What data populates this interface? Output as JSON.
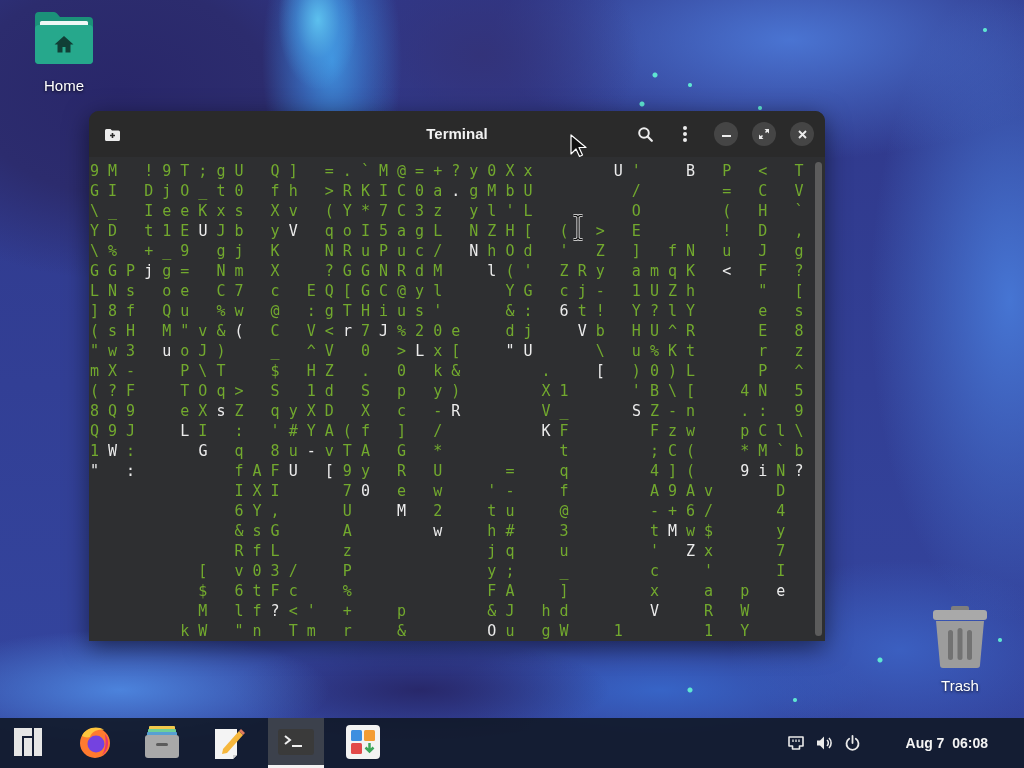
{
  "desktop_icons": [
    {
      "kind": "folder",
      "label": "Home"
    },
    {
      "kind": "trash",
      "label": "Trash"
    }
  ],
  "window": {
    "title": "Terminal",
    "lines": [
      {
        "runs": [
          [
            {
              "kind": "trail",
              "text": "9 M   ! 9 T ; g U   Q ]   = . ` M @ = + ? y 0 X x         "
            },
            {
              "kind": "head",
              "text": "U"
            },
            {
              "kind": "trail",
              "text": " '     "
            },
            {
              "kind": "head",
              "text": "B"
            },
            {
              "kind": "trail",
              "text": "   P   <   T"
            }
          ]
        ]
      },
      {
        "runs": [
          [
            {
              "kind": "trail",
              "text": "G I   D j O _ t 0   f h   > R K I C 0 a "
            },
            {
              "kind": "head",
              "text": "."
            },
            {
              "kind": "trail",
              "text": " g M b U           /         =   C   V"
            }
          ]
        ]
      },
      {
        "runs": [
          [
            {
              "kind": "trail",
              "text": "\\ _   I e e K x s   X v   ( Y * 7 C 3 z   y l ' L           O         (   H   `"
            }
          ]
        ]
      },
      {
        "runs": [
          [
            {
              "kind": "trail",
              "text": "Y D   t 1 E "
            },
            {
              "kind": "head",
              "text": "U"
            },
            {
              "kind": "trail",
              "text": " J b   y "
            },
            {
              "kind": "head",
              "text": "V"
            },
            {
              "kind": "trail",
              "text": "   q o I 5 a g L   N Z H [   ("
            }
          ],
          [
            {
              "kind": "trail",
              "text": "   >   E         !   D   ,"
            }
          ]
        ]
      },
      {
        "runs": [
          [
            {
              "kind": "trail",
              "text": "\\ %   + _ 9   g j   K     N R u P u c /   "
            },
            {
              "kind": "head",
              "text": "N"
            },
            {
              "kind": "trail",
              "text": " h O d   '   Z   ]   f N   u   J   g"
            }
          ]
        ]
      },
      {
        "runs": [
          [
            {
              "kind": "trail",
              "text": "G G P "
            },
            {
              "kind": "head",
              "text": "j"
            },
            {
              "kind": "trail",
              "text": " g =   N m   X     ? G G N R d M     "
            },
            {
              "kind": "head",
              "text": "l"
            },
            {
              "kind": "trail",
              "text": " ( '   Z R y   a m q K   "
            },
            {
              "kind": "head",
              "text": "<"
            },
            {
              "kind": "trail",
              "text": "   F   ?"
            }
          ]
        ]
      },
      {
        "runs": [
          [
            {
              "kind": "trail",
              "text": "L N s   o e   C 7   c   E Q [ G C @ y l       Y G   c j -   1 U Z h       \"   ["
            }
          ]
        ]
      },
      {
        "runs": [
          [
            {
              "kind": "trail",
              "text": "] 8 f   Q u   % w   @   : g T H i u s '       & :   "
            },
            {
              "kind": "head",
              "text": "6"
            },
            {
              "kind": "trail",
              "text": " t !   Y ? l Y       e   s"
            }
          ]
        ]
      },
      {
        "runs": [
          [
            {
              "kind": "trail",
              "text": "( s H   M \" v & "
            },
            {
              "kind": "head",
              "text": "("
            },
            {
              "kind": "trail",
              "text": "   C   V < "
            },
            {
              "kind": "head",
              "text": "r"
            },
            {
              "kind": "trail",
              "text": " 7 "
            },
            {
              "kind": "head",
              "text": "J"
            },
            {
              "kind": "trail",
              "text": " % 2 0 e     d j     "
            },
            {
              "kind": "head",
              "text": "V"
            },
            {
              "kind": "trail",
              "text": " b   H U ^ R       E   8"
            }
          ]
        ]
      },
      {
        "runs": [
          [
            {
              "kind": "trail",
              "text": "\" w 3   "
            },
            {
              "kind": "head",
              "text": "u"
            },
            {
              "kind": "trail",
              "text": " o J )     _   ^ V   0   > "
            },
            {
              "kind": "head",
              "text": "L"
            },
            {
              "kind": "trail",
              "text": " x [     "
            },
            {
              "kind": "head",
              "text": "\" U"
            },
            {
              "kind": "trail",
              "text": "       \\   u % K t       r   z"
            }
          ]
        ]
      },
      {
        "runs": [
          [
            {
              "kind": "trail",
              "text": "m X -     P \\ T     $   H Z   .   0   k &         .     "
            },
            {
              "kind": "head",
              "text": "["
            },
            {
              "kind": "trail",
              "text": "   ) 0 ) L       P   ^"
            }
          ]
        ]
      },
      {
        "runs": [
          [
            {
              "kind": "trail",
              "text": "( ? F     T O q >   S   1 d   S   p   y )         X 1       ' B \\ [     4 N   5"
            }
          ]
        ]
      },
      {
        "runs": [
          [
            {
              "kind": "trail",
              "text": "8 Q 9     e X "
            },
            {
              "kind": "head",
              "text": "s"
            },
            {
              "kind": "trail",
              "text": " Z   q y X D   X   c   - "
            },
            {
              "kind": "head",
              "text": "R"
            },
            {
              "kind": "trail",
              "text": "         V _       "
            },
            {
              "kind": "head",
              "text": "S"
            },
            {
              "kind": "trail",
              "text": " Z - n     . :   9"
            }
          ]
        ]
      },
      {
        "runs": [
          [
            {
              "kind": "trail",
              "text": "Q 9 J     "
            },
            {
              "kind": "head",
              "text": "L"
            },
            {
              "kind": "trail",
              "text": " I   :   ' # Y A ( f   ]   /           "
            },
            {
              "kind": "head",
              "text": "K"
            },
            {
              "kind": "trail",
              "text": " F         F z w     p C l \\"
            }
          ]
        ]
      },
      {
        "runs": [
          [
            {
              "kind": "trail",
              "text": "1 "
            },
            {
              "kind": "head",
              "text": "W"
            },
            {
              "kind": "trail",
              "text": " :       "
            },
            {
              "kind": "head",
              "text": "G"
            },
            {
              "kind": "trail",
              "text": "   q   8 u "
            },
            {
              "kind": "head",
              "text": "-"
            },
            {
              "kind": "trail",
              "text": " v T A   G   *             t         ; C (     * M ` b"
            }
          ]
        ]
      },
      {
        "runs": [
          [
            {
              "kind": "head",
              "text": "\"   :"
            },
            {
              "kind": "trail",
              "text": "           f A F "
            },
            {
              "kind": "head",
              "text": "U   ["
            },
            {
              "kind": "trail",
              "text": " 9 y   R   U       =     q         4 ] (     "
            },
            {
              "kind": "head",
              "text": "9 i"
            },
            {
              "kind": "trail",
              "text": " N "
            },
            {
              "kind": "head",
              "text": "?"
            }
          ]
        ]
      },
      {
        "runs": [
          [
            {
              "kind": "trail",
              "text": "                I X I       7 "
            },
            {
              "kind": "head",
              "text": "0"
            },
            {
              "kind": "trail",
              "text": "   e   w     ' -     f         A 9 A v       D"
            }
          ]
        ]
      },
      {
        "runs": [
          [
            {
              "kind": "trail",
              "text": "                6 Y ,       U     "
            },
            {
              "kind": "head",
              "text": "M"
            },
            {
              "kind": "trail",
              "text": "   2     t u     @         - + 6 /       4"
            }
          ]
        ]
      },
      {
        "runs": [
          [
            {
              "kind": "trail",
              "text": "                & s G       A         "
            },
            {
              "kind": "head",
              "text": "w"
            },
            {
              "kind": "trail",
              "text": "     h #     3         t "
            },
            {
              "kind": "head",
              "text": "M"
            },
            {
              "kind": "trail",
              "text": " w $       y"
            }
          ]
        ]
      },
      {
        "runs": [
          [
            {
              "kind": "trail",
              "text": "                R f L       z               j q     u         '   "
            },
            {
              "kind": "head",
              "text": "Z"
            },
            {
              "kind": "trail",
              "text": " x       7"
            }
          ]
        ]
      },
      {
        "runs": [
          [
            {
              "kind": "trail",
              "text": "            [   v 0 3 /     P               y ;     _         c     '       I"
            }
          ]
        ]
      },
      {
        "runs": [
          [
            {
              "kind": "trail",
              "text": "            $   6 t F c     %               F A     ]         x     a   p   "
            },
            {
              "kind": "head",
              "text": "e"
            }
          ]
        ]
      },
      {
        "runs": [
          [
            {
              "kind": "trail",
              "text": "            M   l f "
            },
            {
              "kind": "head",
              "text": "?"
            },
            {
              "kind": "trail",
              "text": " < '   +     p         & J   h d         "
            },
            {
              "kind": "head",
              "text": "V"
            },
            {
              "kind": "trail",
              "text": "     R   W"
            }
          ]
        ]
      },
      {
        "runs": [
          [
            {
              "kind": "trail",
              "text": "          k W   \" n   T m   r     &         "
            },
            {
              "kind": "head",
              "text": "O"
            },
            {
              "kind": "trail",
              "text": " u   g W     1         1   Y"
            }
          ]
        ]
      }
    ]
  },
  "taskbar": {
    "apps": [
      {
        "kind": "menu",
        "selected": false
      },
      {
        "kind": "browser",
        "selected": false
      },
      {
        "kind": "files",
        "selected": false
      },
      {
        "kind": "editor",
        "selected": false
      },
      {
        "kind": "terminal",
        "selected": true
      },
      {
        "kind": "store",
        "selected": false
      }
    ],
    "clock": "Aug 7  06:08"
  }
}
